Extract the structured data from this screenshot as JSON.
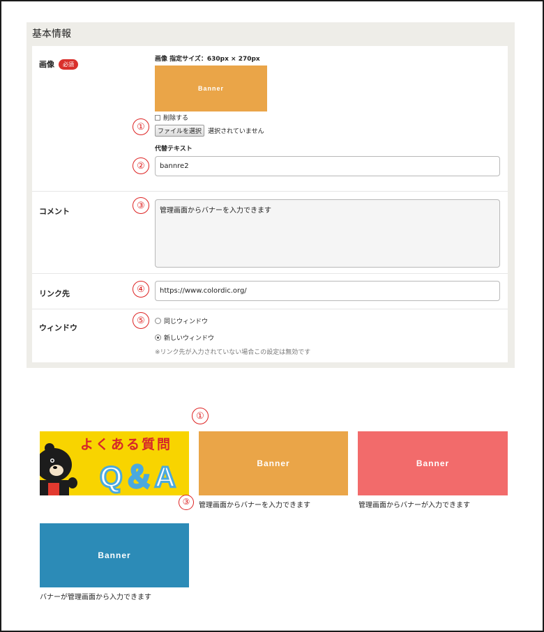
{
  "section": {
    "title": "基本情報"
  },
  "image_row": {
    "label": "画像",
    "required_badge": "必須",
    "size_label": "画像 指定サイズ：630px × 270px",
    "preview_text": "Banner",
    "delete_label": "削除する",
    "file_button": "ファイルを選択",
    "file_status": "選択されていません",
    "alt_label": "代替テキスト",
    "alt_value": "bannre2"
  },
  "comment_row": {
    "label": "コメント",
    "value": "管理画面からバナーを入力できます"
  },
  "link_row": {
    "label": "リンク先",
    "value": "https://www.colordic.org/"
  },
  "window_row": {
    "label": "ウィンドウ",
    "option_same": "同じウィンドウ",
    "option_new": "新しいウィンドウ",
    "selected": "新しいウィンドウ",
    "note": "※リンク先が入力されていない場合この設定は無効です"
  },
  "markers": {
    "m1": "①",
    "m2": "②",
    "m3": "③",
    "m4": "④",
    "m5": "⑤"
  },
  "gallery": {
    "faq": {
      "line1": "よくある質問",
      "line2": "Q＆A"
    },
    "items": [
      {
        "banner": "Banner",
        "color": "#eaa548",
        "caption": "管理画面からバナーを入力できます"
      },
      {
        "banner": "Banner",
        "color": "#f26b6b",
        "caption": "管理画面からバナーが入力できます"
      },
      {
        "banner": "Banner",
        "color": "#2c8bb7",
        "caption": "バナーが管理画面から入力できます"
      }
    ]
  },
  "colors": {
    "orange": "#eaa548",
    "red": "#f26b6b",
    "blue": "#2c8bb7",
    "yellow": "#f8d400",
    "marker": "#dd2222"
  }
}
